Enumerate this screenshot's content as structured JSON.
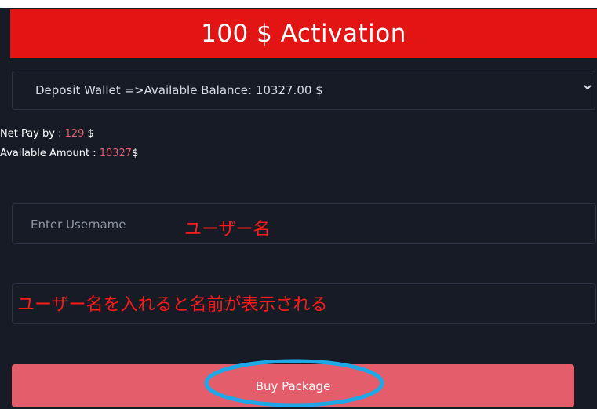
{
  "header": {
    "title": "100 $ Activation",
    "bg_color": "#e31414"
  },
  "wallet_select": {
    "selected": "Deposit Wallet =>Available Balance: 10327.00 $",
    "chevron_icon": "chevron-down-icon"
  },
  "info": {
    "net_pay_label": "Net Pay by : ",
    "net_pay_value": "129",
    "net_pay_currency": " $",
    "available_label": "Available Amount : ",
    "available_value": "10327",
    "available_currency": "$"
  },
  "username_input": {
    "placeholder": "Enter Username"
  },
  "name_display": {
    "value": ""
  },
  "annotations": {
    "username_note": "ユーザー名",
    "name_note": "ユーザー名を入れると名前が表示される",
    "color": "#ff1a1a",
    "highlight_color": "#1ea8e8"
  },
  "buy_button": {
    "label": "Buy Package",
    "color": "#e35d6a"
  }
}
